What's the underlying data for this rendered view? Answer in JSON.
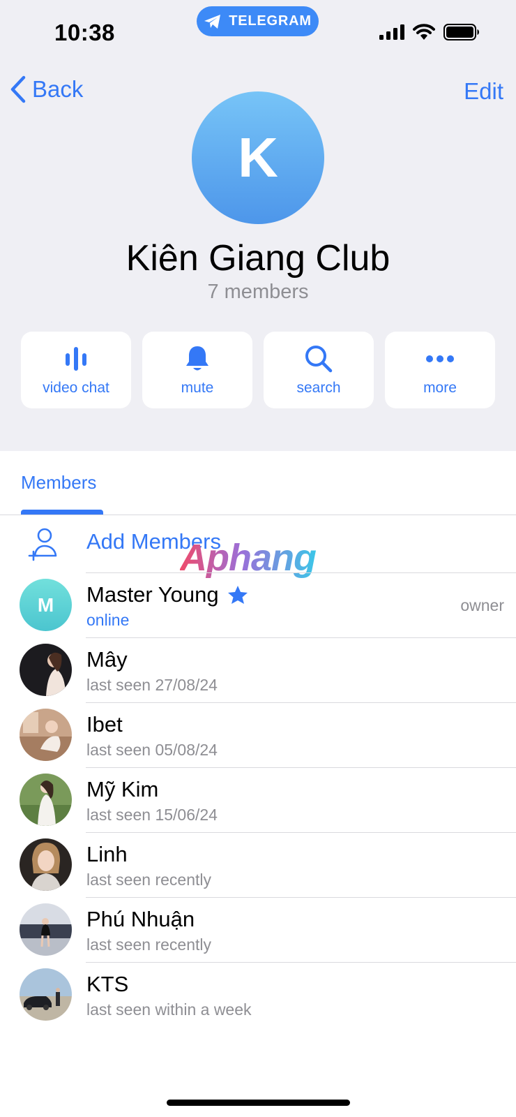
{
  "status_bar": {
    "time": "10:38",
    "app_pill": "TELEGRAM"
  },
  "nav": {
    "back_label": "Back",
    "edit_label": "Edit"
  },
  "group": {
    "avatar_initial": "K",
    "title": "Kiên Giang Club",
    "member_count": "7 members"
  },
  "actions": [
    {
      "label": "video chat",
      "icon": "audio-wave-icon"
    },
    {
      "label": "mute",
      "icon": "bell-icon"
    },
    {
      "label": "search",
      "icon": "search-icon"
    },
    {
      "label": "more",
      "icon": "ellipsis-icon"
    }
  ],
  "tabs": {
    "active": "Members"
  },
  "add_members_label": "Add Members",
  "watermark": "Aphang",
  "members": [
    {
      "name": "Master Young",
      "status": "online",
      "role": "owner",
      "initial": "M",
      "badge": "star-icon"
    },
    {
      "name": "Mây",
      "status": "last seen 27/08/24"
    },
    {
      "name": "Ibet",
      "status": "last seen 05/08/24"
    },
    {
      "name": "Mỹ Kim",
      "status": "last seen 15/06/24"
    },
    {
      "name": "Linh",
      "status": "last seen recently"
    },
    {
      "name": "Phú Nhuận",
      "status": "last seen recently"
    },
    {
      "name": "KTS",
      "status": "last seen within a week"
    }
  ],
  "colors": {
    "accent": "#3478f6",
    "background_top": "#efeff4",
    "secondary_text": "#8e8e93"
  }
}
